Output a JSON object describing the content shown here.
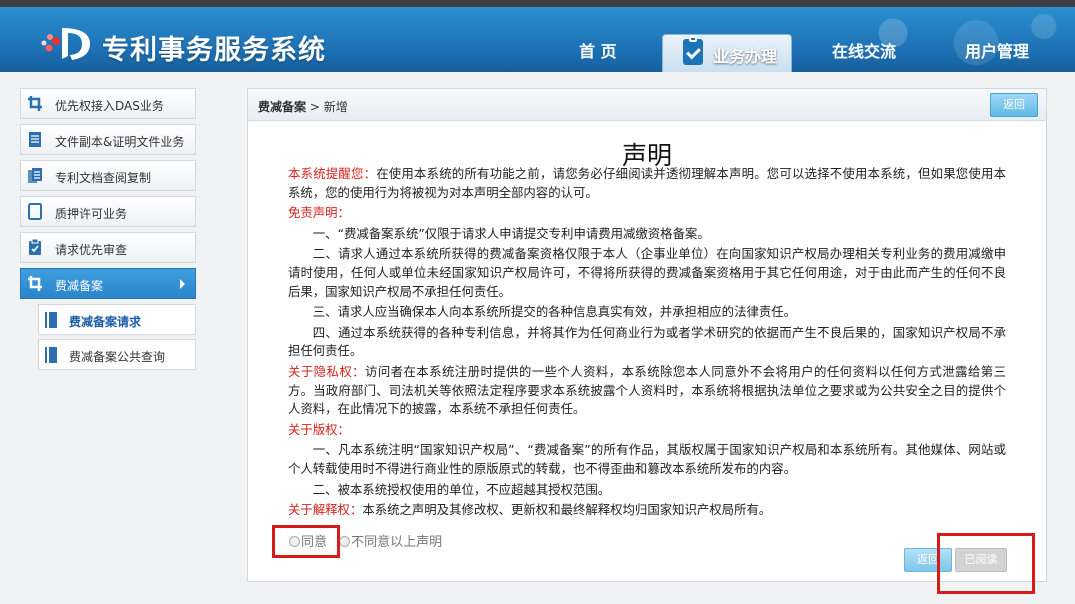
{
  "app": {
    "title": "专利事务服务系统"
  },
  "nav": {
    "items": [
      "首 页",
      "业务办理",
      "在线交流",
      "用户管理"
    ],
    "active": "业务办理"
  },
  "sidebar": {
    "items": [
      "优先权接入DAS业务",
      "文件副本&证明文件业务",
      "专利文档查阅复制",
      "质押许可业务",
      "请求优先审查",
      "费减备案"
    ],
    "active": "费减备案",
    "sub_items": [
      "费减备案请求",
      "费减备案公共查询"
    ],
    "selected_sub": "费减备案请求"
  },
  "breadcrumb": {
    "section": "费减备案",
    "sep": ">",
    "page": "新增"
  },
  "buttons": {
    "back_top": "返回",
    "back_bottom": "返回",
    "read": "已阅读"
  },
  "document": {
    "title": "声明",
    "reminder_label": "本系统提醒您：",
    "reminder_text": "在使用本系统的所有功能之前，请您务必仔细阅读并透彻理解本声明。您可以选择不使用本系统，但如果您使用本系统，您的使用行为将被视为对本声明全部内容的认可。",
    "disclaimer_label": "免责声明：",
    "d1": "一、“费减备案系统”仅限于请求人申请提交专利申请费用减缴资格备案。",
    "d2": "二、请求人通过本系统所获得的费减备案资格仅限于本人（企事业单位）在向国家知识产权局办理相关专利业务的费用减缴申请时使用，任何人或单位未经国家知识产权局许可，不得将所获得的费减备案资格用于其它任何用途，对于由此而产生的任何不良后果，国家知识产权局不承担任何责任。",
    "d3": "三、请求人应当确保本人向本系统所提交的各种信息真实有效，并承担相应的法律责任。",
    "d4": "四、通过本系统获得的各种专利信息，并将其作为任何商业行为或者学术研究的依据而产生不良后果的，国家知识产权局不承担任何责任。",
    "privacy_label": "关于隐私权：",
    "privacy_text": "访问者在本系统注册时提供的一些个人资料，本系统除您本人同意外不会将用户的任何资料以任何方式泄露给第三方。当政府部门、司法机关等依照法定程序要求本系统披露个人资料时，本系统将根据执法单位之要求或为公共安全之目的提供个人资料，在此情况下的披露，本系统不承担任何责任。",
    "copyright_label": "关于版权：",
    "c1": "一、凡本系统注明“国家知识产权局”、“费减备案”的所有作品，其版权属于国家知识产权局和本系统所有。其他媒体、网站或个人转载使用时不得进行商业性的原版原式的转载，也不得歪曲和篡改本系统所发布的内容。",
    "c2": "二、被本系统授权使用的单位，不应超越其授权范围。",
    "interpret_label": "关于解释权：",
    "interpret_text": "本系统之声明及其修改权、更新权和最终解释权均归国家知识产权局所有。"
  },
  "consent": {
    "agree": "同意",
    "disagree": "不同意以上声明"
  },
  "colors": {
    "header_blue": "#1c6fb2",
    "highlight_red": "#d61b1b",
    "accent_red_text": "#d6231e"
  }
}
